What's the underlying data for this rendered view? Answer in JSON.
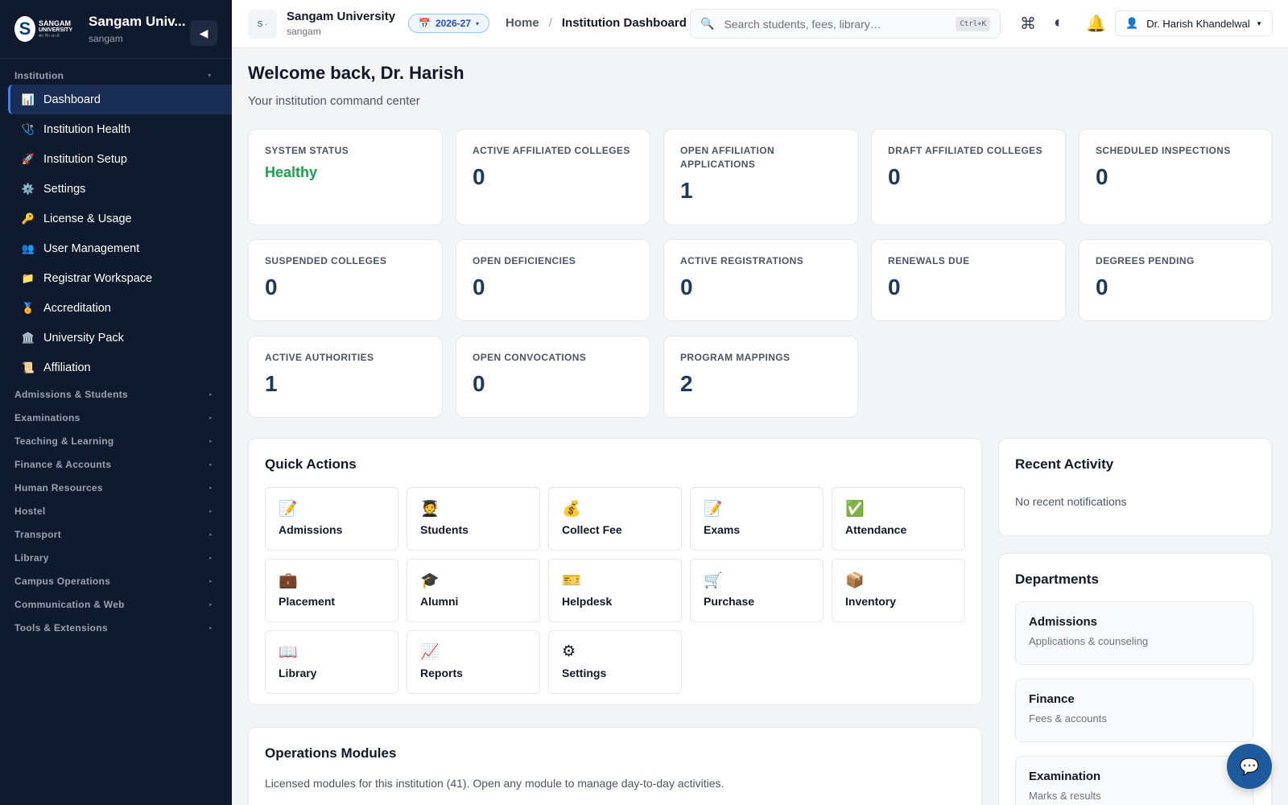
{
  "sidebar": {
    "org_name": "Sangam Univ...",
    "org_slug": "sangam",
    "logo": {
      "line1": "SANGAM",
      "line2": "UNIVERSITY",
      "line3": "सा। वि। अ। से"
    },
    "collapse_icon": "◀",
    "group_institution": "Institution",
    "items": [
      {
        "label": "Dashboard",
        "icon": "📊"
      },
      {
        "label": "Institution Health",
        "icon": "🩺"
      },
      {
        "label": "Institution Setup",
        "icon": "🚀"
      },
      {
        "label": "Settings",
        "icon": "⚙️"
      },
      {
        "label": "License & Usage",
        "icon": "🔑"
      },
      {
        "label": "User Management",
        "icon": "👥"
      },
      {
        "label": "Registrar Workspace",
        "icon": "📁"
      },
      {
        "label": "Accreditation",
        "icon": "🏅"
      },
      {
        "label": "University Pack",
        "icon": "🏛️"
      },
      {
        "label": "Affiliation",
        "icon": "📜"
      }
    ],
    "groups": [
      "Admissions & Students",
      "Examinations",
      "Teaching & Learning",
      "Finance & Accounts",
      "Human Resources",
      "Hostel",
      "Transport",
      "Library",
      "Campus Operations",
      "Communication & Web",
      "Tools & Extensions"
    ]
  },
  "topbar": {
    "inst_name": "Sangam University",
    "inst_slug": "sangam",
    "year": "2026-27",
    "crumb_home": "Home",
    "crumb_sep": "/",
    "crumb_current": "Institution Dashboard",
    "search_placeholder": "Search students, fees, library…",
    "search_shortcut": "Ctrl+K",
    "user_name": "Dr. Harish Khandelwal"
  },
  "main": {
    "welcome": "Welcome back, Dr. Harish",
    "subtitle": "Your institution command center",
    "stats": [
      {
        "label": "SYSTEM STATUS",
        "value": "Healthy"
      },
      {
        "label": "ACTIVE AFFILIATED COLLEGES",
        "value": "0"
      },
      {
        "label": "OPEN AFFILIATION APPLICATIONS",
        "value": "1"
      },
      {
        "label": "DRAFT AFFILIATED COLLEGES",
        "value": "0"
      },
      {
        "label": "SCHEDULED INSPECTIONS",
        "value": "0"
      },
      {
        "label": "SUSPENDED COLLEGES",
        "value": "0"
      },
      {
        "label": "OPEN DEFICIENCIES",
        "value": "0"
      },
      {
        "label": "ACTIVE REGISTRATIONS",
        "value": "0"
      },
      {
        "label": "RENEWALS DUE",
        "value": "0"
      },
      {
        "label": "DEGREES PENDING",
        "value": "0"
      },
      {
        "label": "ACTIVE AUTHORITIES",
        "value": "1"
      },
      {
        "label": "OPEN CONVOCATIONS",
        "value": "0"
      },
      {
        "label": "PROGRAM MAPPINGS",
        "value": "2"
      }
    ],
    "quick_actions_title": "Quick Actions",
    "quick_actions": [
      {
        "label": "Admissions",
        "icon": "📝"
      },
      {
        "label": "Students",
        "icon": "🧑‍🎓"
      },
      {
        "label": "Collect Fee",
        "icon": "💰"
      },
      {
        "label": "Exams",
        "icon": "📝"
      },
      {
        "label": "Attendance",
        "icon": "✅"
      },
      {
        "label": "Placement",
        "icon": "💼"
      },
      {
        "label": "Alumni",
        "icon": "🎓"
      },
      {
        "label": "Helpdesk",
        "icon": "🎫"
      },
      {
        "label": "Purchase",
        "icon": "🛒"
      },
      {
        "label": "Inventory",
        "icon": "📦"
      },
      {
        "label": "Library",
        "icon": "📖"
      },
      {
        "label": "Reports",
        "icon": "📈"
      },
      {
        "label": "Settings",
        "icon": "⚙"
      }
    ],
    "ops_title": "Operations Modules",
    "ops_desc": "Licensed modules for this institution (41). Open any module to manage day-to-day activities.",
    "recent_title": "Recent Activity",
    "recent_empty": "No recent notifications",
    "departments_title": "Departments",
    "departments": [
      {
        "name": "Admissions",
        "desc": "Applications & counseling"
      },
      {
        "name": "Finance",
        "desc": "Fees & accounts"
      },
      {
        "name": "Examination",
        "desc": "Marks & results"
      }
    ]
  },
  "colors": {
    "sidebar_bg": "#0f1a2e",
    "accent": "#1e3a5f",
    "healthy": "#16a34a",
    "chat_button": "#1e5a9e"
  }
}
